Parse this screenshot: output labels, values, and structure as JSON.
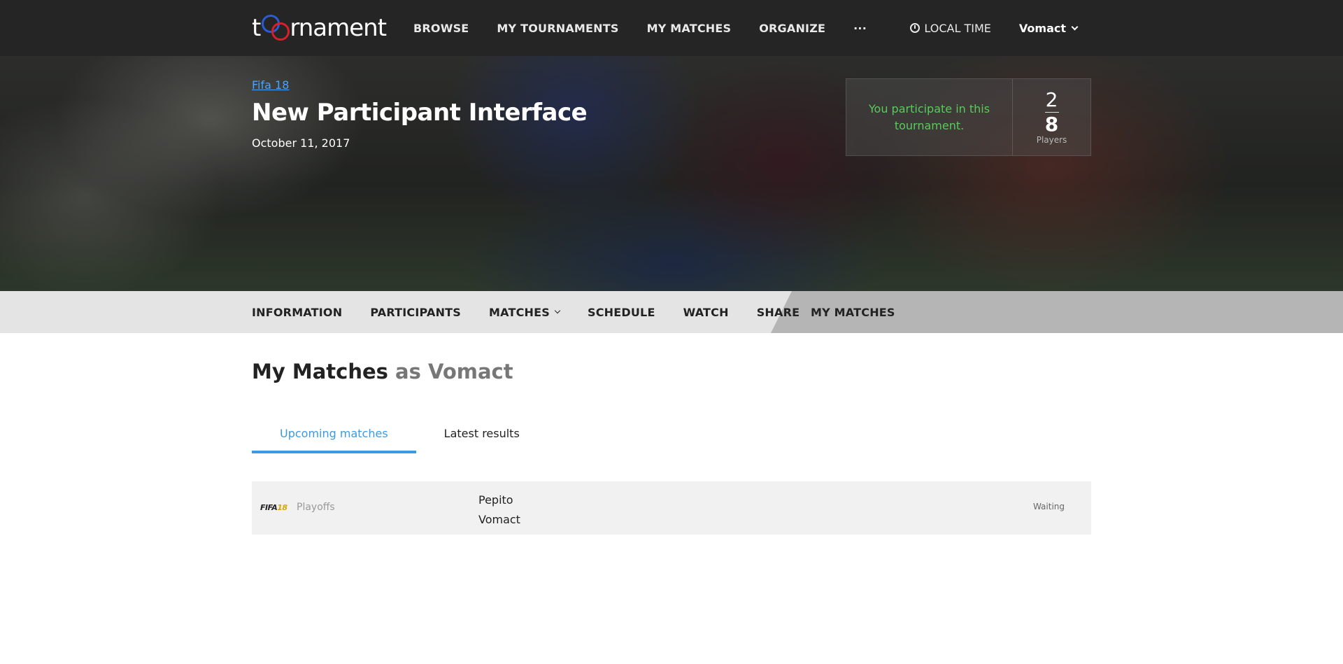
{
  "header": {
    "logo_prefix": "t",
    "logo_suffix": "rnament",
    "nav": [
      "BROWSE",
      "MY TOURNAMENTS",
      "MY MATCHES",
      "ORGANIZE",
      "···"
    ],
    "local_time": "LOCAL TIME",
    "user": "Vomact"
  },
  "hero": {
    "game": "Fifa 18",
    "title": "New Participant Interface",
    "date": "October 11, 2017",
    "participation_msg": "You participate in this tournament.",
    "players_count": "2",
    "players_max": "8",
    "players_label": "Players"
  },
  "subnav": {
    "items": [
      "INFORMATION",
      "PARTICIPANTS",
      "MATCHES",
      "SCHEDULE",
      "WATCH",
      "SHARE"
    ],
    "active": "MY MATCHES"
  },
  "content": {
    "heading_strong": "My Matches",
    "heading_light": "as Vomact",
    "tabs": [
      "Upcoming matches",
      "Latest results"
    ],
    "matches": [
      {
        "game_logo_a": "FIFA",
        "game_logo_b": "18",
        "phase": "Playoffs",
        "opponent_1": "Pepito",
        "opponent_2": "Vomact",
        "status": "Waiting"
      }
    ]
  },
  "colors": {
    "topbar": "#252525",
    "accent": "#3c99e6",
    "participate": "#5cc95c",
    "link": "#4aa3ff"
  }
}
